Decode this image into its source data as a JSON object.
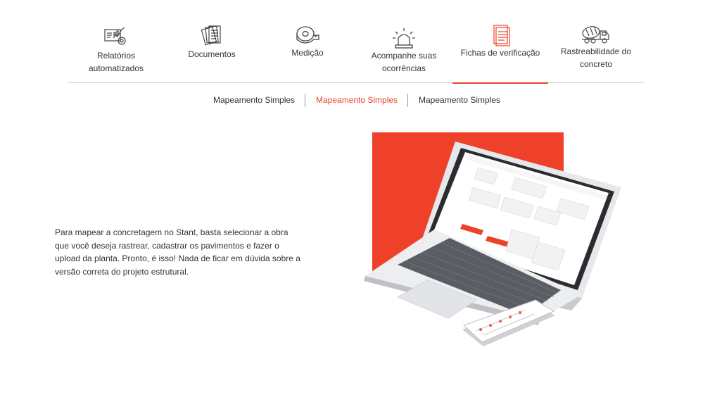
{
  "tabs": [
    {
      "label_line1": "Relatórios",
      "label_line2": "automatizados",
      "icon": "report-chart-icon"
    },
    {
      "label_line1": "Documentos",
      "label_line2": "",
      "icon": "documents-icon"
    },
    {
      "label_line1": "Medição",
      "label_line2": "",
      "icon": "tape-measure-icon"
    },
    {
      "label_line1": "Acompanhe suas",
      "label_line2": "ocorrências",
      "icon": "siren-icon"
    },
    {
      "label_line1": "Fichas de verificação",
      "label_line2": "",
      "icon": "checklist-icon",
      "active": true
    },
    {
      "label_line1": "Rastreabilidade do",
      "label_line2": "concreto",
      "icon": "concrete-mixer-truck-icon"
    }
  ],
  "subtabs": [
    {
      "label": "Mapeamento Simples"
    },
    {
      "label": "Mapeamento Simples",
      "active": true
    },
    {
      "label": "Mapeamento Simples"
    }
  ],
  "description": "Para mapear a concretagem no Stant, basta selecionar a obra que você deseja rastrear, cadastrar os pavimentos e fazer o upload da planta. Pronto, é isso! Nada de ficar em dúvida sobre a versão correta do projeto estrutural.",
  "colors": {
    "accent": "#ef4129",
    "text": "#333333",
    "divider": "#cfcfcf"
  }
}
